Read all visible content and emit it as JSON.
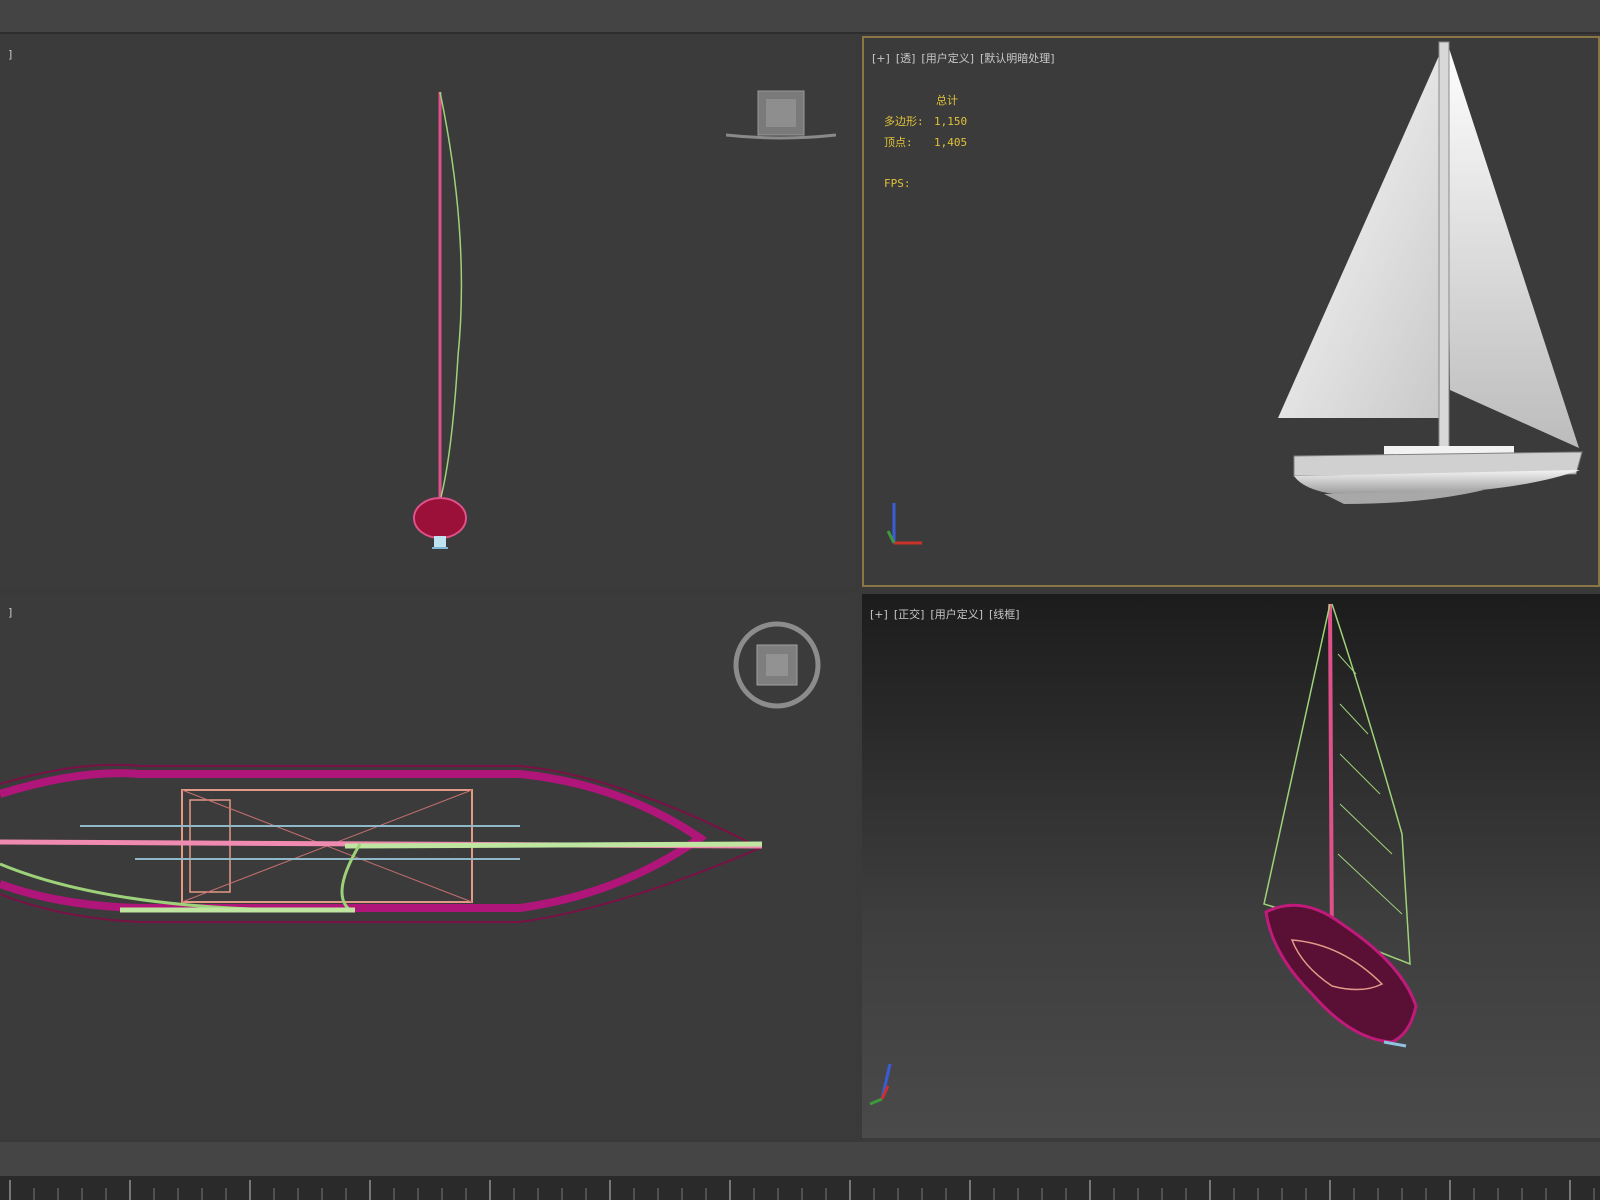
{
  "viewports": {
    "top_left": {
      "label": "]"
    },
    "top_right": {
      "label_parts": [
        "[+]",
        "[透]",
        "[用户定义]",
        "[默认明暗处理]"
      ],
      "stats_header": "总计",
      "stats": [
        {
          "key": "多边形:",
          "value": "1,150"
        },
        {
          "key": "顶点:",
          "value": "1,405"
        }
      ],
      "fps": "FPS:"
    },
    "bottom_left": {
      "label": "]"
    },
    "bottom_right": {
      "label_parts": [
        "[+]",
        "[正交]",
        "[用户定义]",
        "[线框]"
      ]
    }
  },
  "colors": {
    "viewport_bg": "#3b3b3b",
    "active_border": "#8a7644",
    "stats_text": "#e0c23a",
    "mast": "#e0508a",
    "sail_wire": "#9ed27a",
    "hull_wire": "#b0157a"
  },
  "icons": [
    "viewcube-icon",
    "steering-wheel-icon",
    "axis-gizmo-icon"
  ]
}
